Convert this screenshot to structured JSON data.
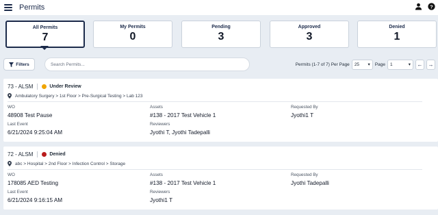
{
  "app": {
    "title": "Permits"
  },
  "summary": [
    {
      "label": "All Permits",
      "count": "7"
    },
    {
      "label": "My Permits",
      "count": "0"
    },
    {
      "label": "Pending",
      "count": "3"
    },
    {
      "label": "Approved",
      "count": "3"
    },
    {
      "label": "Denied",
      "count": "1"
    }
  ],
  "toolbar": {
    "filters_label": "Filters",
    "search_placeholder": "Search Permits...",
    "count_text": "Permits (1-7 of 7) Per Page",
    "per_page": "25",
    "page_label": "Page",
    "page": "1"
  },
  "field_labels": {
    "wo": "WO",
    "assets": "Assets",
    "requested_by": "Requested By",
    "last_event": "Last Event",
    "reviewers": "Reviewers"
  },
  "permits": [
    {
      "id": "73 - ALSM",
      "status": "Under Review",
      "status_color": "#f0a500",
      "location": "Ambulatory Surgery > 1st Floor > Pre-Surgical Testing > Lab 123",
      "wo": "48908 Test Pause",
      "assets": "#138 - 2017 Test Vehicle 1",
      "requested_by": "Jyothi1 T",
      "last_event": "6/21/2024 9:25:04 AM",
      "reviewers": "Jyothi T, Jyothi Tadepalli"
    },
    {
      "id": "72 - ALSM",
      "status": "Denied",
      "status_color": "#b91c1c",
      "location": "abc > Hospital > 2nd Floor > Infection Control > Storage",
      "wo": "178085 AED Testing",
      "assets": "#138 - 2017 Test Vehicle 1",
      "requested_by": "Jyothi Tadepalli",
      "last_event": "6/21/2024 9:16:15 AM",
      "reviewers": "Jyothi1 T"
    }
  ]
}
